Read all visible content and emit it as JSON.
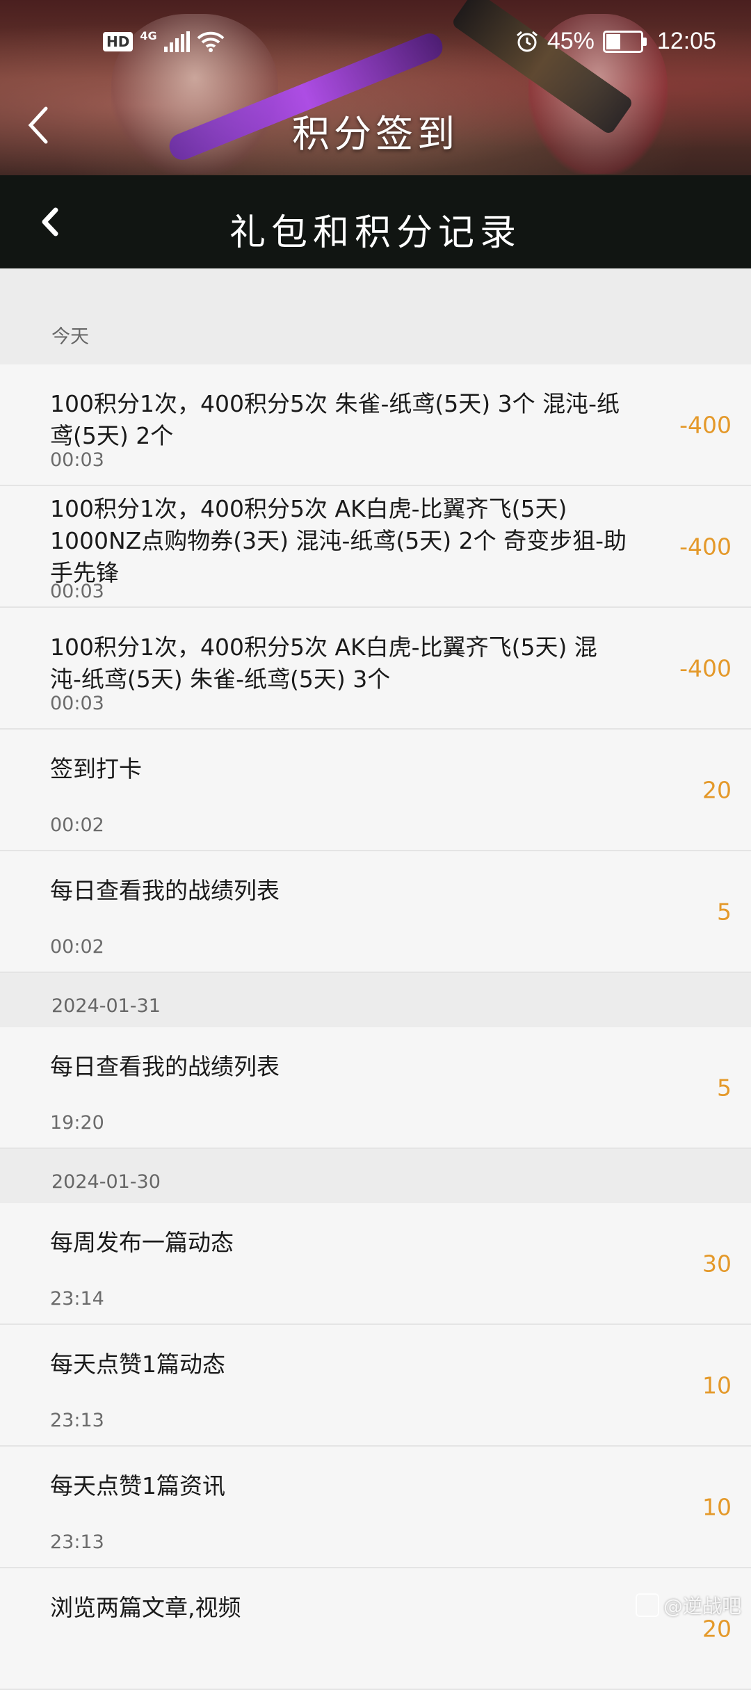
{
  "status_bar": {
    "hd": "HD",
    "network": "4G",
    "battery_percent": "45%",
    "battery_level": 0.45,
    "time": "12:05",
    "icons": [
      "signal-icon",
      "wifi-icon",
      "alarm-icon",
      "battery-icon"
    ]
  },
  "banner": {
    "title": "积分签到"
  },
  "header": {
    "title": "礼包和积分记录"
  },
  "groups": [
    {
      "date": "今天",
      "items": [
        {
          "title": "100积分1次，400积分5次 朱雀-纸鸢(5天) 3个 混沌-纸鸢(5天) 2个",
          "time": "00:03",
          "points": "-400"
        },
        {
          "title": "100积分1次，400积分5次 AK白虎-比翼齐飞(5天) 1000NZ点购物券(3天) 混沌-纸鸢(5天) 2个 奇变步狙-助手先锋",
          "time": "00:03",
          "points": "-400"
        },
        {
          "title": "100积分1次，400积分5次 AK白虎-比翼齐飞(5天) 混沌-纸鸢(5天) 朱雀-纸鸢(5天) 3个",
          "time": "00:03",
          "points": "-400"
        },
        {
          "title": "签到打卡",
          "time": "00:02",
          "points": "20"
        },
        {
          "title": "每日查看我的战绩列表",
          "time": "00:02",
          "points": "5"
        }
      ]
    },
    {
      "date": "2024-01-31",
      "items": [
        {
          "title": "每日查看我的战绩列表",
          "time": "19:20",
          "points": "5"
        }
      ]
    },
    {
      "date": "2024-01-30",
      "items": [
        {
          "title": "每周发布一篇动态",
          "time": "23:14",
          "points": "30"
        },
        {
          "title": "每天点赞1篇动态",
          "time": "23:13",
          "points": "10"
        },
        {
          "title": "每天点赞1篇资讯",
          "time": "23:13",
          "points": "10"
        },
        {
          "title": "浏览两篇文章,视频",
          "time": "",
          "points": "20"
        }
      ]
    }
  ],
  "watermark": "@逆战吧",
  "colors": {
    "accent": "#e4992a",
    "header_bg": "#111512",
    "list_bg": "#f6f6f6",
    "section_bg": "#ececec"
  }
}
